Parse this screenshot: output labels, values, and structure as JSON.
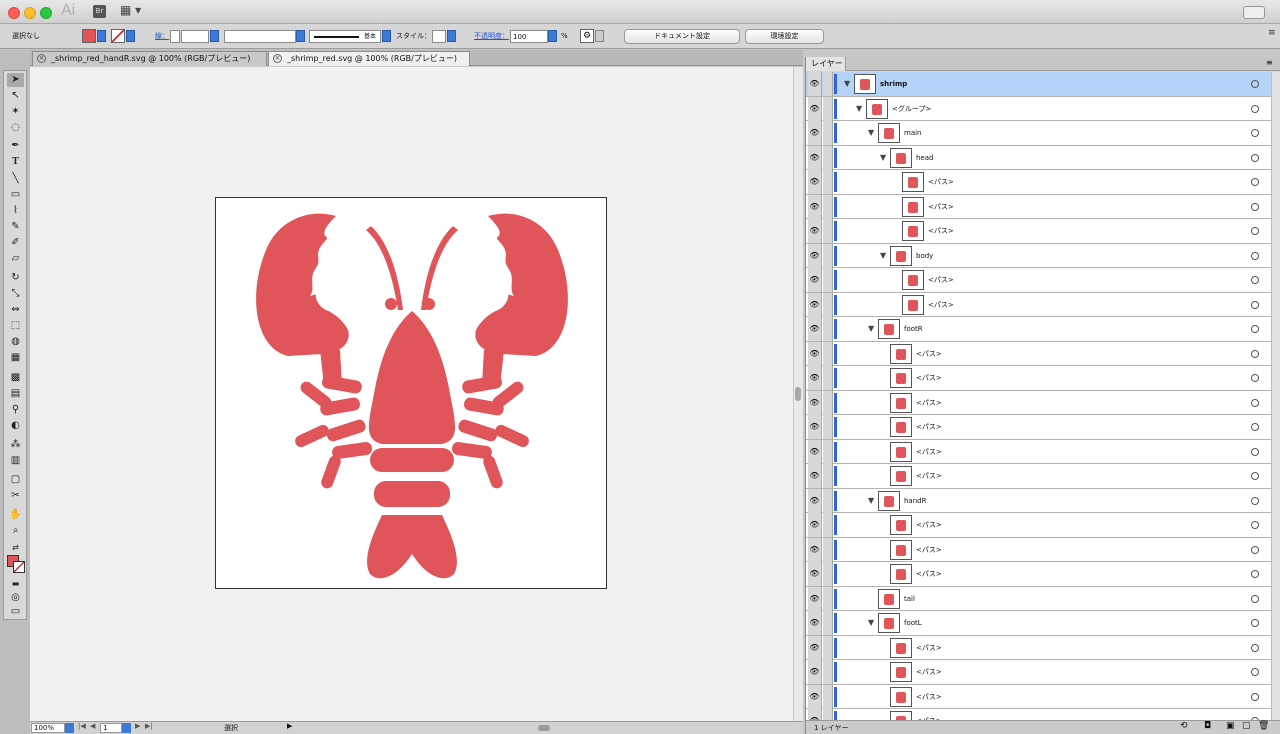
{
  "app": {
    "logo": "Ai",
    "bridge": "Br",
    "arrange": "▦"
  },
  "colors": {
    "fill": "#e0555a",
    "accent": "#3b7ad6",
    "selection": "#b3d3f8"
  },
  "control_bar": {
    "selection": "選択なし",
    "stroke_label": "線：",
    "stroke_style": "基本",
    "style_label": "スタイル：",
    "opacity_label": "不透明度：",
    "opacity_value": "100",
    "percent": "%",
    "doc_setup": "ドキュメント設定",
    "preferences": "環境設定"
  },
  "tabs": [
    {
      "label": "_shrimp_red_handR.svg @ 100% (RGB/プレビュー)",
      "active": false
    },
    {
      "label": "_shrimp_red.svg @ 100% (RGB/プレビュー)",
      "active": true
    }
  ],
  "status": {
    "zoom": "100%",
    "artboard": "1",
    "tool": "選択"
  },
  "layers_panel": {
    "title": "レイヤー",
    "footer": "1 レイヤー",
    "rows": [
      {
        "label": "shrimp",
        "bold": true
      },
      {
        "label": "<グループ>"
      },
      {
        "label": "main"
      },
      {
        "label": "head"
      },
      {
        "label": "<パス>"
      },
      {
        "label": "<パス>"
      },
      {
        "label": "<パス>"
      },
      {
        "label": "body"
      },
      {
        "label": "<パス>"
      },
      {
        "label": "<パス>"
      },
      {
        "label": "footR"
      },
      {
        "label": "<パス>"
      },
      {
        "label": "<パス>"
      },
      {
        "label": "<パス>"
      },
      {
        "label": "<パス>"
      },
      {
        "label": "<パス>"
      },
      {
        "label": "<パス>"
      },
      {
        "label": "handR"
      },
      {
        "label": "<パス>"
      },
      {
        "label": "<パス>"
      },
      {
        "label": "<パス>"
      },
      {
        "label": "tail"
      },
      {
        "label": "footL"
      },
      {
        "label": "<パス>"
      },
      {
        "label": "<パス>"
      },
      {
        "label": "<パス>"
      },
      {
        "label": "<パス>"
      }
    ]
  }
}
